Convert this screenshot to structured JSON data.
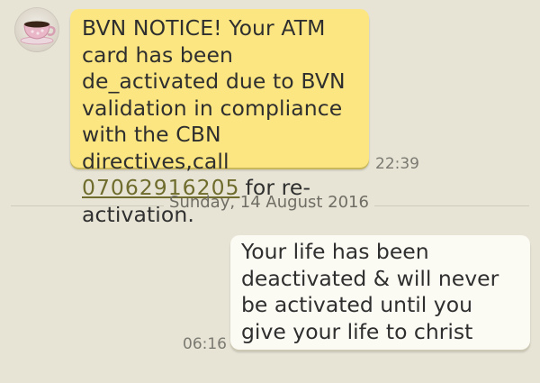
{
  "received_message": {
    "text_before_link": "BVN NOTICE! Your ATM card has been de_activated due to BVN validation in compliance with the CBN directives,call",
    "phone_link": "07062916205",
    "text_after_link": "for re-activation.",
    "time": "22:39"
  },
  "date_divider": {
    "label": "Sunday, 14 August 2016"
  },
  "sent_message": {
    "text": "Your life has been deactivated & will never be activated until you give your life to christ",
    "time": "06:16"
  },
  "contact": {
    "avatar_icon": "teacup-avatar-icon"
  }
}
